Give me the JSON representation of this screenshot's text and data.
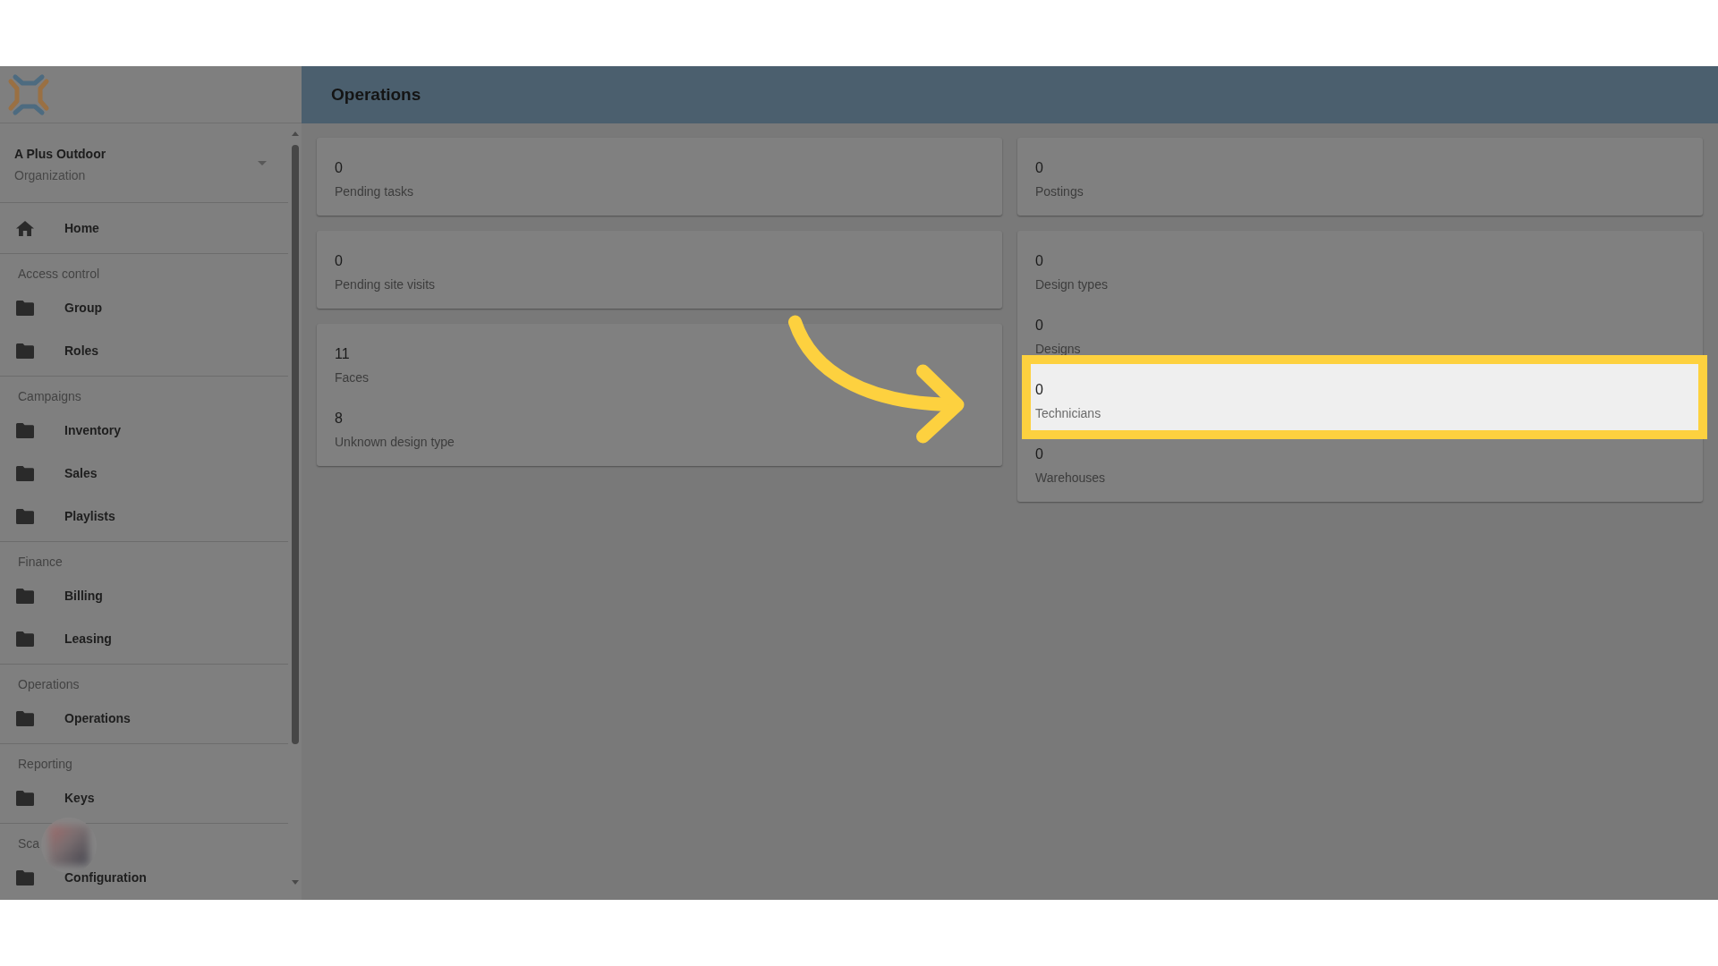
{
  "sidebar": {
    "organization": {
      "name": "A Plus Outdoor",
      "type": "Organization"
    },
    "home": {
      "label": "Home"
    },
    "sections": [
      {
        "title": "Access control",
        "items": [
          {
            "label": "Group"
          },
          {
            "label": "Roles"
          }
        ]
      },
      {
        "title": "Campaigns",
        "items": [
          {
            "label": "Inventory"
          },
          {
            "label": "Sales"
          },
          {
            "label": "Playlists"
          }
        ]
      },
      {
        "title": "Finance",
        "items": [
          {
            "label": "Billing"
          },
          {
            "label": "Leasing"
          }
        ]
      },
      {
        "title": "Operations",
        "items": [
          {
            "label": "Operations"
          }
        ]
      },
      {
        "title": "Reporting",
        "items": [
          {
            "label": "Keys"
          }
        ]
      },
      {
        "title": "Sca",
        "items": [
          {
            "label": "Configuration"
          }
        ]
      }
    ]
  },
  "header": {
    "title": "Operations"
  },
  "columns": [
    {
      "cards": [
        {
          "stats": [
            {
              "value": "0",
              "label": "Pending tasks",
              "highlighted": false
            }
          ]
        },
        {
          "stats": [
            {
              "value": "0",
              "label": "Pending site visits",
              "highlighted": false
            }
          ]
        },
        {
          "stats": [
            {
              "value": "11",
              "label": "Faces",
              "highlighted": false
            },
            {
              "value": "8",
              "label": "Unknown design type",
              "highlighted": false
            }
          ]
        }
      ]
    },
    {
      "cards": [
        {
          "stats": [
            {
              "value": "0",
              "label": "Postings",
              "highlighted": false
            }
          ]
        },
        {
          "stats": [
            {
              "value": "0",
              "label": "Design types",
              "highlighted": false
            },
            {
              "value": "0",
              "label": "Designs",
              "highlighted": false
            },
            {
              "value": "0",
              "label": "Technicians",
              "highlighted": true
            },
            {
              "value": "0",
              "label": "Warehouses",
              "highlighted": false
            }
          ]
        }
      ]
    }
  ]
}
